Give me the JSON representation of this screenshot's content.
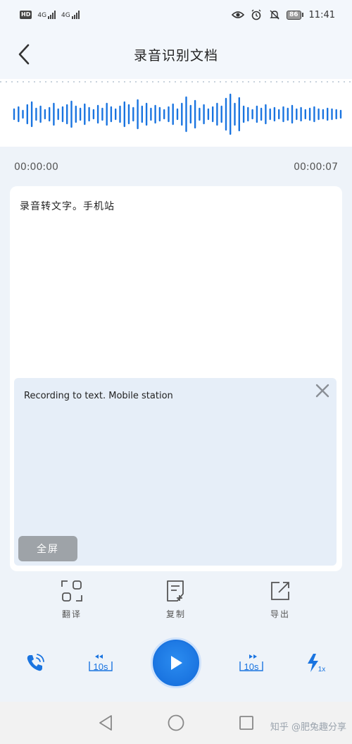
{
  "status_bar": {
    "hd": "HD",
    "net1": "4G",
    "net2": "4G",
    "battery": "86",
    "time": "11:41"
  },
  "header": {
    "title": "录音识别文档",
    "back_icon": "chevron-left-icon"
  },
  "playback_times": {
    "current": "00:00:00",
    "total": "00:00:07"
  },
  "transcript": {
    "text": "录音转文字。手机站"
  },
  "translation": {
    "text": "Recording to text. Mobile station",
    "fullscreen_label": "全屏"
  },
  "actions": [
    {
      "label": "翻译",
      "icon": "translate-icon"
    },
    {
      "label": "复制",
      "icon": "copy-icon"
    },
    {
      "label": "导出",
      "icon": "export-icon"
    }
  ],
  "playback": {
    "rewind_label": "10s",
    "forward_label": "10s",
    "speed_label": "1x"
  },
  "watermark": "知乎 @肥兔趣分享",
  "colors": {
    "accent": "#1a74e0",
    "background": "#eef3f9",
    "panel": "#e6eef8"
  }
}
